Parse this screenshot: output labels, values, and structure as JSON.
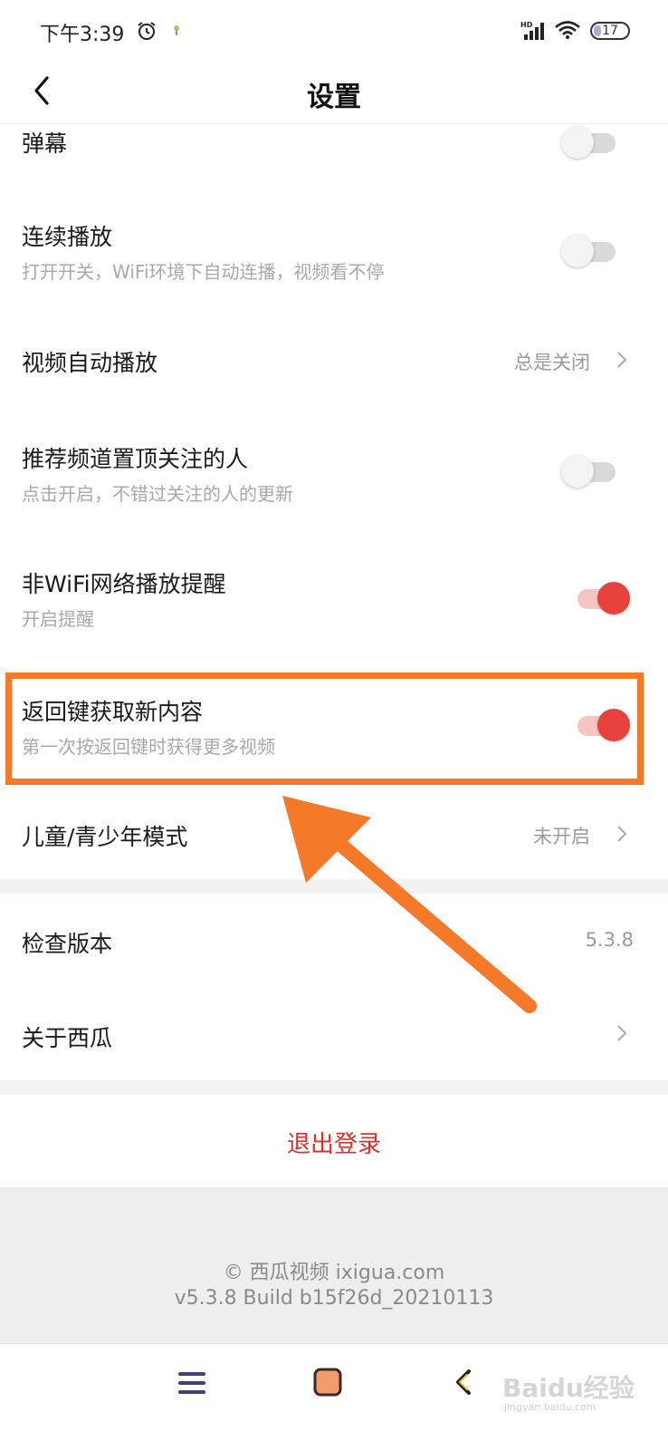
{
  "status_bar": {
    "time": "下午3:39",
    "network_label": "HD",
    "battery_level": "17"
  },
  "header": {
    "title": "设置"
  },
  "settings": [
    {
      "title": "弹幕",
      "control": "toggle",
      "on": false
    },
    {
      "title": "连续播放",
      "subtitle": "打开开关，WiFi环境下自动连播，视频看不停",
      "control": "toggle",
      "on": false
    },
    {
      "title": "视频自动播放",
      "value": "总是关闭",
      "control": "link"
    },
    {
      "title": "推荐频道置顶关注的人",
      "subtitle": "点击开启，不错过关注的人的更新",
      "control": "toggle",
      "on": false
    },
    {
      "title": "非WiFi网络播放提醒",
      "subtitle": "开启提醒",
      "control": "toggle",
      "on": true
    },
    {
      "title": "返回键获取新内容",
      "subtitle": "第一次按返回键时获得更多视频",
      "control": "toggle",
      "on": true
    },
    {
      "title": "儿童/青少年模式",
      "value": "未开启",
      "control": "link"
    }
  ],
  "about": {
    "check_version_label": "检查版本",
    "version_value": "5.3.8",
    "about_label": "关于西瓜"
  },
  "logout": {
    "label": "退出登录"
  },
  "footer": {
    "copyright": "© 西瓜视频 ixigua.com",
    "build": "v5.3.8 Build b15f26d_20210113"
  },
  "watermark": {
    "text": "Baidu经验",
    "url": "jingyan.baidu.com"
  },
  "colors": {
    "accent_red": "#e8403b",
    "logout_red": "#d8312c",
    "annotation_orange": "#f47a2a"
  },
  "icons": [
    "back-icon",
    "alarm-icon",
    "signal-icon",
    "wifi-icon",
    "chevron-right-icon",
    "menu-icon",
    "home-icon",
    "system-back-icon",
    "arrow-annotation"
  ]
}
